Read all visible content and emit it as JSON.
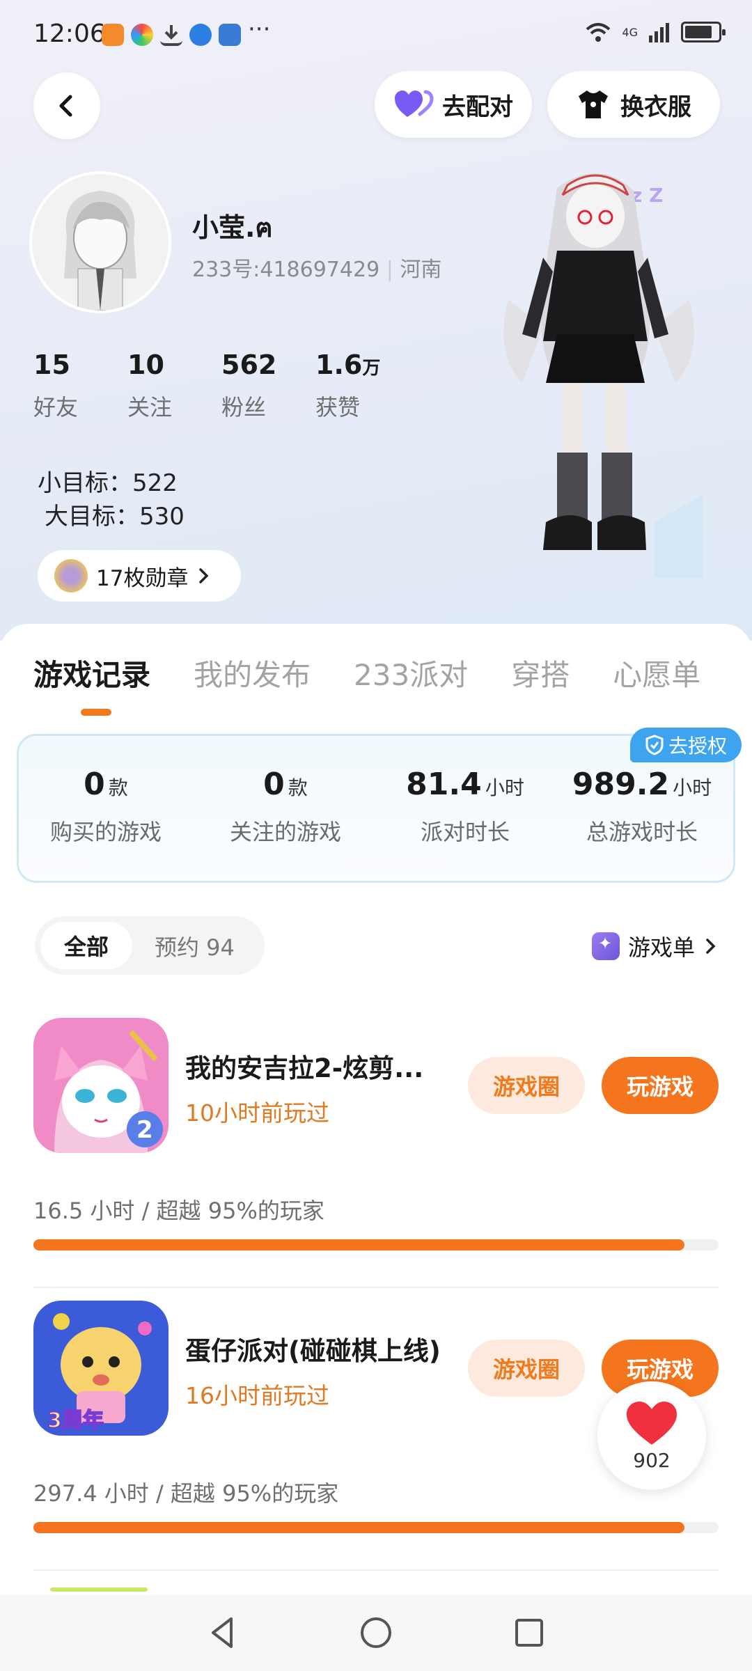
{
  "status_bar": {
    "time": "12:06",
    "network": "4G",
    "more": "···"
  },
  "header": {
    "pair_label": "去配对",
    "outfit_label": "换衣服"
  },
  "profile": {
    "name": "小莹.ฅ",
    "uid": "233号:418697429",
    "location": "河南",
    "stats": [
      {
        "value": "15",
        "unit": "",
        "label": "好友"
      },
      {
        "value": "10",
        "unit": "",
        "label": "关注"
      },
      {
        "value": "562",
        "unit": "",
        "label": "粉丝"
      },
      {
        "value": "1.6",
        "unit": "万",
        "label": "获赞"
      }
    ],
    "small_goal": "小目标：522",
    "big_goal": "大目标：530",
    "medals_label": "17枚勋章"
  },
  "tabs": [
    "游戏记录",
    "我的发布",
    "233派对",
    "穿搭",
    "心愿单"
  ],
  "summary": {
    "auth_label": "去授权",
    "items": [
      {
        "value": "0",
        "unit": "款",
        "label": "购买的游戏"
      },
      {
        "value": "0",
        "unit": "款",
        "label": "关注的游戏"
      },
      {
        "value": "81.4",
        "unit": "小时",
        "label": "派对时长"
      },
      {
        "value": "989.2",
        "unit": "小时",
        "label": "总游戏时长"
      }
    ]
  },
  "filter": {
    "all": "全部",
    "reserved": "预约 94",
    "gamelist": "游戏单"
  },
  "games": [
    {
      "title": "我的安吉拉2-炫剪...",
      "last_played": "10小时前玩过",
      "circle_label": "游戏圈",
      "play_label": "玩游戏",
      "stat_text": "16.5 小时 / 超越 95%的玩家",
      "progress": 0.95
    },
    {
      "title": "蛋仔派对(碰碰棋上线)",
      "last_played": "16小时前玩过",
      "circle_label": "游戏圈",
      "play_label": "玩游戏",
      "stat_text": "297.4 小时 / 超越 95%的玩家",
      "progress": 0.95
    }
  ],
  "like_fab": {
    "count": "902"
  },
  "colors": {
    "accent": "#f4751d",
    "auth_blue": "#3ea4f0",
    "pair_purple": "#7a5af5"
  }
}
